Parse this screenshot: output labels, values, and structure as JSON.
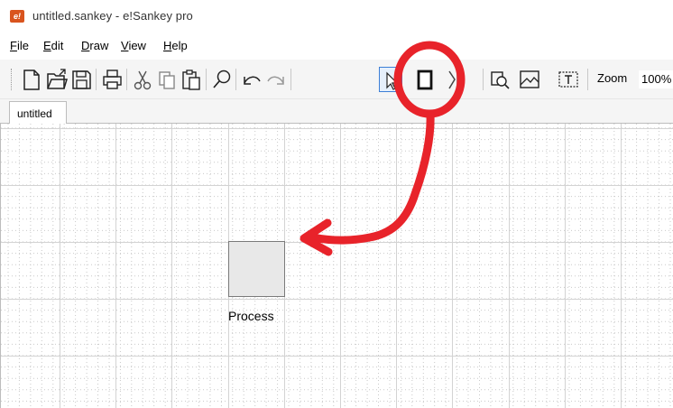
{
  "window": {
    "app_icon_text": "e!",
    "title": "untitled.sankey - e!Sankey pro"
  },
  "menu": {
    "items": [
      {
        "accel": "F",
        "rest": "ile"
      },
      {
        "accel": "E",
        "rest": "dit"
      },
      {
        "accel": "D",
        "rest": "raw"
      },
      {
        "accel": "V",
        "rest": "iew"
      },
      {
        "accel": "H",
        "rest": "elp"
      }
    ]
  },
  "toolbar": {
    "icons": [
      "new-file-icon",
      "open-folder-icon",
      "save-icon",
      "print-icon",
      "cut-icon",
      "copy-icon",
      "paste-icon",
      "search-icon",
      "undo-icon",
      "redo-icon",
      "select-arrow-icon",
      "process-node-icon",
      "entry-exit-icon",
      "zoom-region-icon",
      "image-icon",
      "text-box-icon"
    ],
    "zoom_label": "Zoom",
    "zoom_value": "100%"
  },
  "tabs": {
    "active": "untitled"
  },
  "canvas": {
    "process_label": "Process"
  },
  "annotation": {
    "color": "#e8232a"
  }
}
